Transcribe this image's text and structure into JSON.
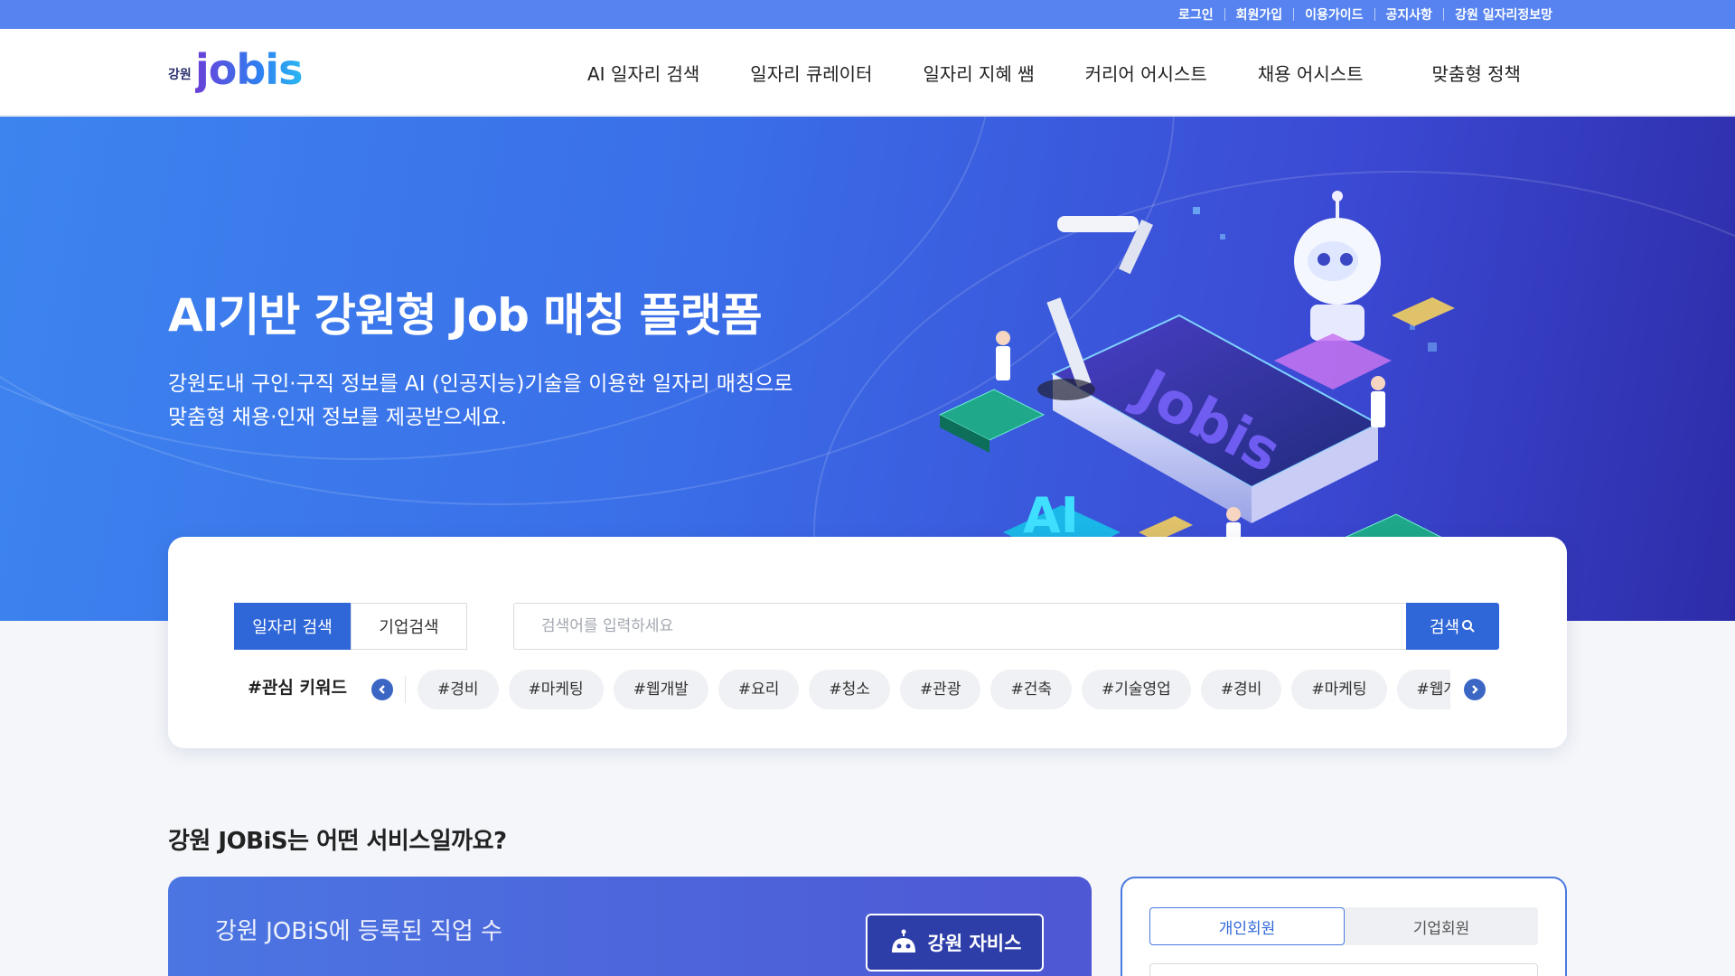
{
  "topbar": {
    "links": [
      "로그인",
      "회원가입",
      "이용가이드",
      "공지사항",
      "강원 일자리정보망"
    ]
  },
  "header": {
    "logo_small": "강원",
    "logo_big": "jobis",
    "nav": [
      "AI 일자리 검색",
      "일자리 큐레이터",
      "일자리 지혜 쌤",
      "커리어 어시스트",
      "채용 어시스트",
      "맞춤형 정책"
    ]
  },
  "hero": {
    "title": "AI기반 강원형 Job 매칭 플랫폼",
    "desc_line1": "강원도내 구인·구직 정보를 AI (인공지능)기술을 이용한 일자리 매칭으로",
    "desc_line2": "맞춤형 채용·인재 정보를 제공받으세요.",
    "illustration_texts": {
      "screen_word": "Jobis",
      "ai_word": "AI"
    }
  },
  "search": {
    "tabs": [
      "일자리 검색",
      "기업검색"
    ],
    "active_tab": "일자리 검색",
    "placeholder": "검색어를 입력하세요",
    "value": "",
    "button_label": "검색",
    "keyword_title": "#관심 키워드",
    "keywords": [
      "#경비",
      "#마케팅",
      "#웹개발",
      "#요리",
      "#청소",
      "#관광",
      "#건축",
      "#기술영업",
      "#경비",
      "#마케팅",
      "#웹개발"
    ]
  },
  "section": {
    "title": "강원 JOBiS는 어떤 서비스일까요?",
    "stat_label": "강원 JOBiS에 등록된 직업 수",
    "jarvis_button": "강원 자비스",
    "member_tabs": [
      "개인회원",
      "기업회원"
    ],
    "active_member_tab": "개인회원"
  },
  "colors": {
    "topbar": "#5683ef",
    "primary": "#2f67d8",
    "hero_start": "#3d84ef",
    "hero_end": "#2d2ca8"
  },
  "icons": [
    "search-icon",
    "chevron-left-icon",
    "chevron-right-icon",
    "robot-icon"
  ]
}
